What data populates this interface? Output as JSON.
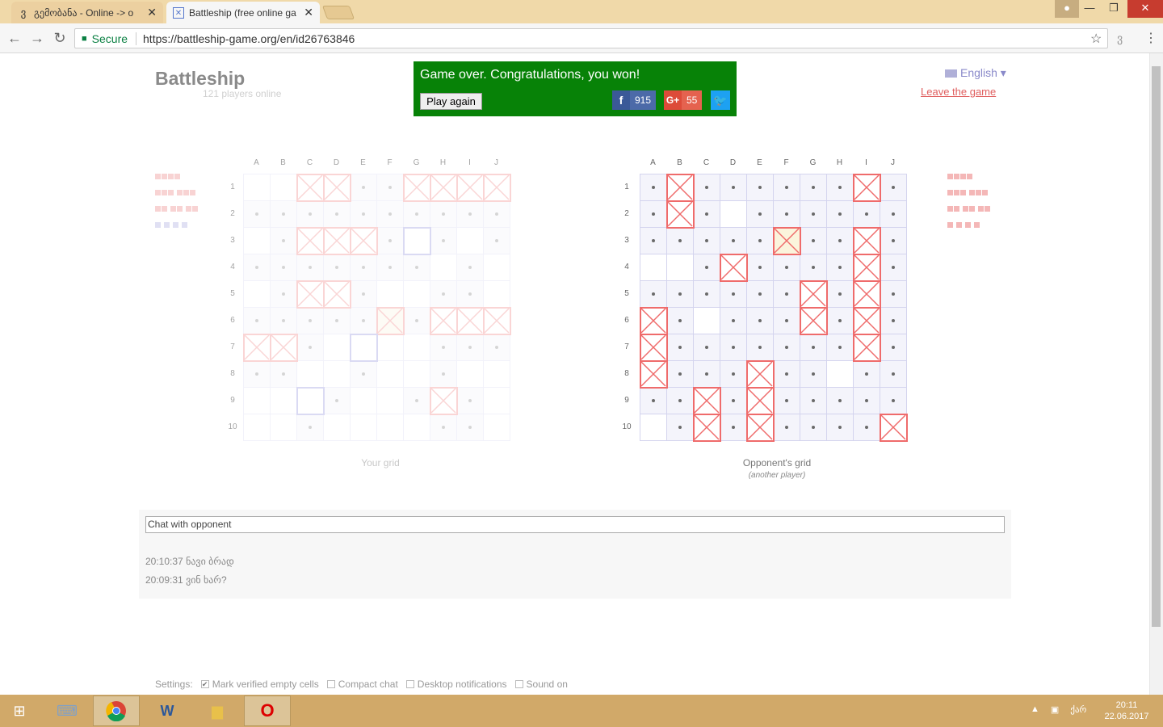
{
  "browser": {
    "tabs": [
      {
        "icon": "georgian-letter-icon",
        "title": "გემობანა - Online -> o"
      },
      {
        "icon": "battleship-icon",
        "title": "Battleship (free online ga"
      }
    ],
    "secure_label": "Secure",
    "url": "https://battleship-game.org/en/id26763846"
  },
  "header": {
    "logo": "Battleship",
    "players_online": "121 players online",
    "language": "English",
    "leave": "Leave the game"
  },
  "banner": {
    "message": "Game over. Congratulations, you won!",
    "play_again": "Play again",
    "facebook_count": "915",
    "gplus_label": "G+",
    "gplus_count": "55",
    "color": "#078207"
  },
  "columns": [
    "A",
    "B",
    "C",
    "D",
    "E",
    "F",
    "G",
    "H",
    "I",
    "J"
  ],
  "rows": [
    "1",
    "2",
    "3",
    "4",
    "5",
    "6",
    "7",
    "8",
    "9",
    "10"
  ],
  "my_grid": {
    "caption": "Your grid",
    "cells": [
      "eeHHmmHHHH",
      "mmmmmmmmmm",
      "emHHHmSmem",
      "mmmmmmmeme",
      "emHHmeemme",
      "mmmmmLmHHH",
      "HHmeSeemmm",
      "mmeemeemee",
      "eeSmeemHme",
      "eemeeeemme"
    ]
  },
  "opponent_grid": {
    "caption": "Opponent's grid",
    "subcaption": "(another player)",
    "cells": [
      "mHmmmmmmHm",
      "mHmemmmmmm",
      "mmmmmLmmHm",
      "eemHmmmmHm",
      "mmmmmmHmHm",
      "HmemmmHmHm",
      "HmmmmmmmHm",
      "Hmmmhmmemm",
      "mmHmHmmmmm",
      "emHmHmmmmH"
    ]
  },
  "legend": "H=hit(cross) m=verified-empty e=empty L=last-shot S=highlighted h=hit",
  "chat": {
    "placeholder": "Chat with opponent",
    "messages": [
      {
        "time": "20:10:37",
        "text": "ნავი ბრად"
      },
      {
        "time": "20:09:31",
        "text": "ვინ ხარ?"
      }
    ]
  },
  "settings": {
    "label": "Settings:",
    "options": [
      {
        "label": "Mark verified empty cells",
        "checked": true
      },
      {
        "label": "Compact chat",
        "checked": false
      },
      {
        "label": "Desktop notifications",
        "checked": false
      },
      {
        "label": "Sound on",
        "checked": false
      }
    ]
  },
  "taskbar": {
    "time": "20:11",
    "date": "22.06.2017",
    "lang": "ქარ"
  }
}
